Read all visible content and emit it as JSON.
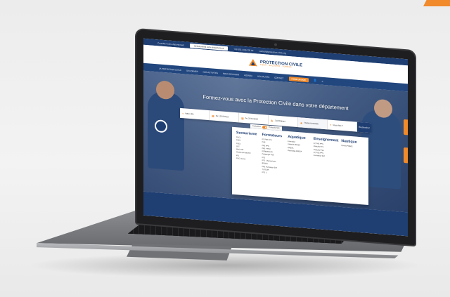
{
  "utility": {
    "label": "Consulter votre département",
    "select": "Sélectionnez votre département",
    "phone": "+33 (0)1 43 84 33 00",
    "email": "contact@protection-civile.org"
  },
  "brand": {
    "name": "PROTECTION CIVILE",
    "tagline": "AIDER · SECOURIR · FORMER"
  },
  "nav": {
    "items": [
      "LA PROTECTION CIVILE",
      "SE FORMER",
      "NOS ACTIVITÉS",
      "NOUS SOUTENIR",
      "AGENDA",
      "ACTUALITÉS",
      "CONTACT"
    ],
    "cta": "FAIRE UN DON"
  },
  "hero": {
    "title": "Formez-vous avec la Protection Civile dans votre département"
  },
  "search": {
    "fields": [
      "Votre ville",
      "Du 12/01/2022",
      "Au 31/12/2022",
      "1 participant",
      "Thème formation",
      "Vous êtes ?"
    ],
    "button": "Rechercher"
  },
  "toggle": {
    "left": "Particuliers",
    "right": "Professionnels"
  },
  "categories": [
    {
      "title": "Secourisme",
      "items": [
        "PSC1",
        "PSE1",
        "PSE2",
        "SST",
        "MAC SST",
        "Gestes qui sauvent",
        "IPS",
        "PSC1 Canin"
      ]
    },
    {
      "title": "Formateurs",
      "items": [
        "FC PAE FPS",
        "PSE",
        "PAE FPS",
        "PAE F PSC",
        "FORMATEUR",
        "Pédagogie PSE",
        "FTS",
        "FTS 2 Secourisme",
        "BNSSA",
        "PAE Formateur SST",
        "TUTEUR",
        "FTS 2"
      ]
    },
    {
      "title": "Aquatique",
      "items": [
        "Formation",
        "Initiation BNSSA",
        "BNSSA",
        "Recyclage BNSSA"
      ]
    },
    {
      "title": "Enseignement",
      "items": [
        "FC PAE FPS",
        "Modules FTS",
        "Modules PSE",
        "FC PSE FPS",
        "Formateur SST"
      ]
    },
    {
      "title": "Nautique",
      "items": [
        "Permis PRBZE"
      ]
    }
  ],
  "colors": {
    "primary": "#1f3f73",
    "accent": "#f08a2a"
  }
}
